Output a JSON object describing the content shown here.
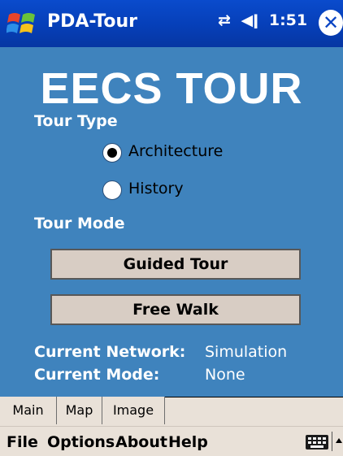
{
  "titlebar": {
    "app_title": "PDA-Tour",
    "time": "1:51",
    "icons": [
      "connectivity-icon",
      "volume-icon",
      "close-icon"
    ]
  },
  "main": {
    "heading": "EECS TOUR",
    "tour_type_label": "Tour Type",
    "tour_type_options": [
      {
        "label": "Architecture",
        "selected": true
      },
      {
        "label": "History",
        "selected": false
      }
    ],
    "tour_mode_label": "Tour Mode",
    "buttons": {
      "guided": "Guided Tour",
      "free": "Free Walk"
    },
    "info": {
      "network_label": "Current Network:",
      "network_value": "Simulation",
      "mode_label": "Current Mode:",
      "mode_value": "None"
    }
  },
  "tabs": [
    {
      "label": "Main",
      "active": true
    },
    {
      "label": "Map",
      "active": false
    },
    {
      "label": "Image",
      "active": false
    }
  ],
  "menu": [
    "File",
    "Options",
    "About",
    "Help"
  ],
  "colors": {
    "background": "#3f83bd",
    "titlebar": "#0a45c4",
    "button_face": "#d8cdc4",
    "bar_face": "#e9e1d8"
  }
}
